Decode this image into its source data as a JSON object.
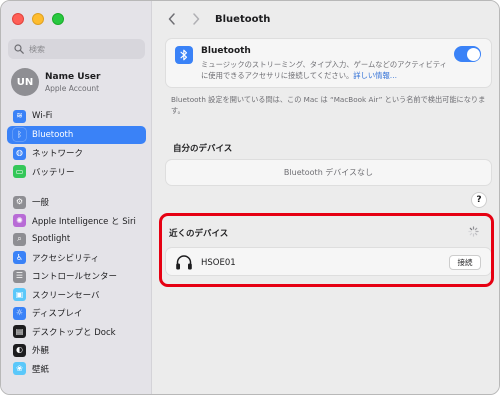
{
  "search": {
    "placeholder": "検索"
  },
  "user": {
    "initials": "UN",
    "name": "Name User",
    "subtitle": "Apple Account"
  },
  "sidebar": {
    "group1": [
      {
        "label": "Wi-Fi",
        "icon": "wifi-icon",
        "color": "#3a82f7",
        "glyph": "≋",
        "active": false
      },
      {
        "label": "Bluetooth",
        "icon": "bluetooth-icon",
        "color": "#3a82f7",
        "glyph": "ᛒ",
        "active": true
      },
      {
        "label": "ネットワーク",
        "icon": "globe-icon",
        "color": "#3a82f7",
        "glyph": "◍",
        "active": false
      },
      {
        "label": "バッテリー",
        "icon": "battery-icon",
        "color": "#34c759",
        "glyph": "▭",
        "active": false
      }
    ],
    "group2": [
      {
        "label": "一般",
        "icon": "gear-icon",
        "color": "#8e8e93",
        "glyph": "⚙"
      },
      {
        "label": "Apple Intelligence と Siri",
        "icon": "siri-icon",
        "color": "#b86bd6",
        "glyph": "✺"
      },
      {
        "label": "Spotlight",
        "icon": "spotlight-icon",
        "color": "#8e8e93",
        "glyph": "⌕"
      },
      {
        "label": "アクセシビリティ",
        "icon": "accessibility-icon",
        "color": "#3a82f7",
        "glyph": "♿"
      },
      {
        "label": "コントロールセンター",
        "icon": "control-center-icon",
        "color": "#8e8e93",
        "glyph": "☰"
      },
      {
        "label": "スクリーンセーバ",
        "icon": "screensaver-icon",
        "color": "#5ac8fa",
        "glyph": "▣"
      },
      {
        "label": "ディスプレイ",
        "icon": "display-icon",
        "color": "#3a82f7",
        "glyph": "☼"
      },
      {
        "label": "デスクトップと Dock",
        "icon": "dock-icon",
        "color": "#1d1d1f",
        "glyph": "▤"
      },
      {
        "label": "外観",
        "icon": "appearance-icon",
        "color": "#1d1d1f",
        "glyph": "◐"
      },
      {
        "label": "壁紙",
        "icon": "wallpaper-icon",
        "color": "#5ac8fa",
        "glyph": "❀"
      }
    ]
  },
  "header": {
    "title": "Bluetooth"
  },
  "bluetooth": {
    "title": "Bluetooth",
    "description": "ミュージックのストリーミング、タイプ入力、ゲームなどのアクティビティに使用できるアクセサリに接続してください。",
    "link": "詳しい情報…",
    "toggle_on": true
  },
  "info_text": "Bluetooth 設定を開いている間は、この Mac は “MacBook Air” という名前で検出可能になります。",
  "my_devices": {
    "label": "自分のデバイス",
    "empty": "Bluetooth デバイスなし"
  },
  "help_label": "?",
  "nearby": {
    "label": "近くのデバイス",
    "devices": [
      {
        "name": "HSOE01",
        "icon": "headphones-icon",
        "button": "接続"
      }
    ]
  },
  "colors": {
    "accent": "#3a82f7",
    "highlight": "#e60012"
  }
}
